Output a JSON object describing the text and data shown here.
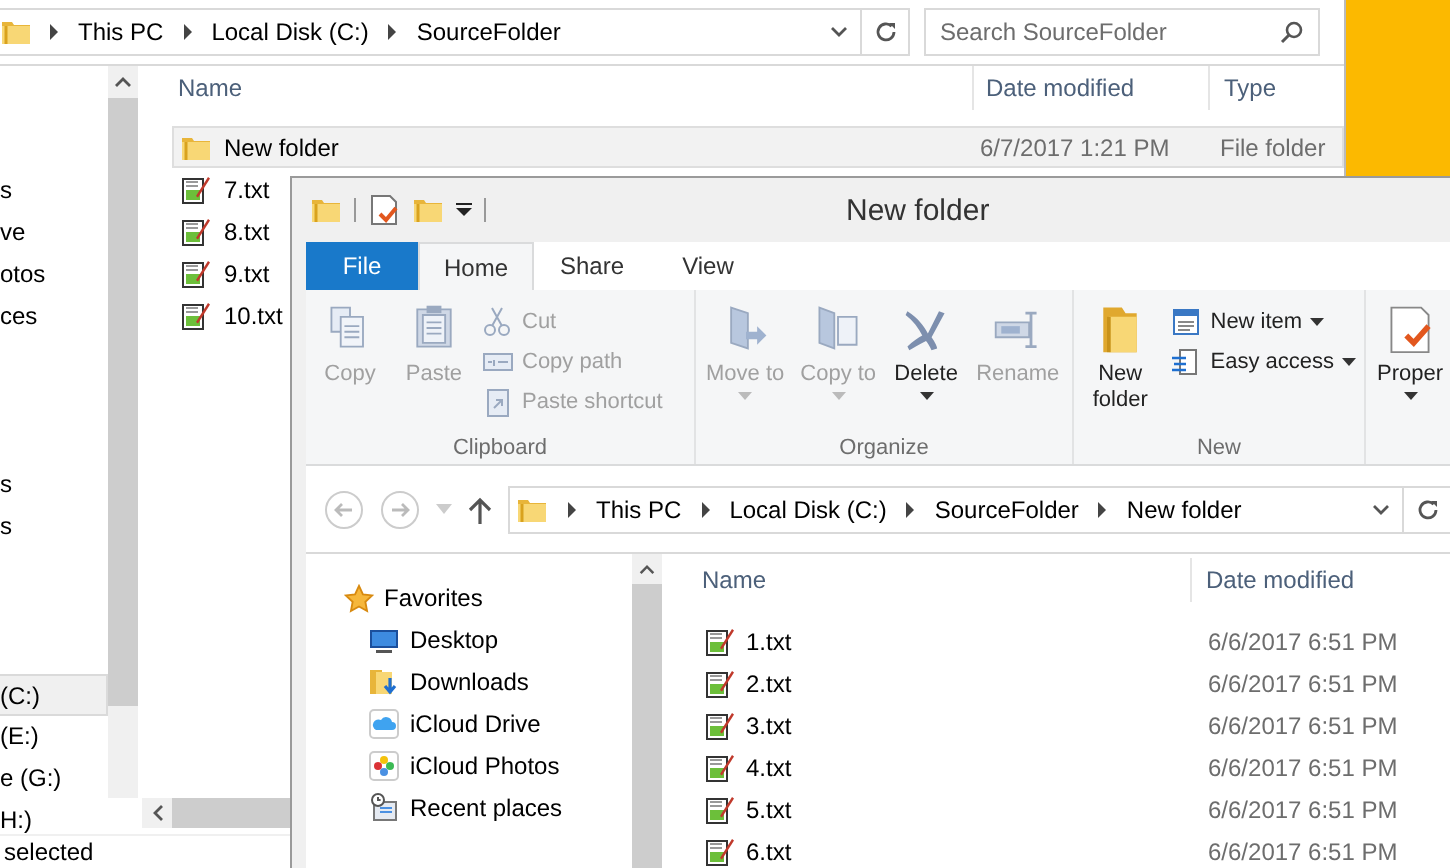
{
  "back_window": {
    "address_bar": {
      "crumbs": [
        "This PC",
        "Local Disk (C:)",
        "SourceFolder"
      ]
    },
    "search": {
      "placeholder": "Search SourceFolder"
    },
    "nav_groups": [
      [
        {
          "label": "s",
          "selected": false
        },
        {
          "label": "ve",
          "selected": false
        },
        {
          "label": "otos",
          "selected": false
        },
        {
          "label": "ces",
          "selected": false
        }
      ],
      [
        {
          "label": "s",
          "selected": false
        },
        {
          "label": "s",
          "selected": false
        }
      ],
      [
        {
          "label": "(C:)",
          "selected": true
        },
        {
          "label": "(E:)",
          "selected": false
        },
        {
          "label": "e (G:)",
          "selected": false
        },
        {
          "label": "H:)",
          "selected": false
        }
      ]
    ],
    "columns": [
      "Name",
      "Date modified",
      "Type"
    ],
    "rows": [
      {
        "kind": "folder",
        "name": "New folder",
        "date": "6/7/2017 1:21 PM",
        "type": "File folder",
        "selected": true
      },
      {
        "kind": "text",
        "name": "7.txt",
        "selected": false
      },
      {
        "kind": "text",
        "name": "8.txt",
        "selected": false
      },
      {
        "kind": "text",
        "name": "9.txt",
        "selected": false
      },
      {
        "kind": "text",
        "name": "10.txt",
        "selected": false
      }
    ],
    "status_bar": "selected"
  },
  "front_window": {
    "title": "New folder",
    "ribbon_tabs": [
      {
        "kind": "menu",
        "label": "File",
        "selected": false
      },
      {
        "kind": "tab",
        "label": "Home",
        "selected": true
      },
      {
        "kind": "tab",
        "label": "Share",
        "selected": false
      },
      {
        "kind": "tab",
        "label": "View",
        "selected": false
      }
    ],
    "ribbon_groups": [
      {
        "label": "Clipboard",
        "buttons": [
          {
            "kind": "large",
            "label": "Copy",
            "disabled": true,
            "dropdown": false
          },
          {
            "kind": "large",
            "label": "Paste",
            "disabled": true,
            "dropdown": false
          },
          {
            "kind": "stack",
            "items": [
              {
                "label": "Cut",
                "disabled": true,
                "dropdown": false
              },
              {
                "label": "Copy path",
                "disabled": true,
                "dropdown": false
              },
              {
                "label": "Paste shortcut",
                "disabled": true,
                "dropdown": false
              }
            ]
          }
        ]
      },
      {
        "label": "Organize",
        "buttons": [
          {
            "kind": "large",
            "label": "Move to",
            "disabled": true,
            "dropdown": true
          },
          {
            "kind": "large",
            "label": "Copy to",
            "disabled": true,
            "dropdown": true
          },
          {
            "kind": "large",
            "label": "Delete",
            "disabled": false,
            "dropdown": true
          },
          {
            "kind": "large",
            "label": "Rename",
            "disabled": true,
            "dropdown": false
          }
        ]
      },
      {
        "label": "New",
        "buttons": [
          {
            "kind": "large",
            "label": "New folder",
            "disabled": false,
            "dropdown": false
          },
          {
            "kind": "stack",
            "items": [
              {
                "label": "New item",
                "disabled": false,
                "dropdown": true
              },
              {
                "label": "Easy access",
                "disabled": false,
                "dropdown": true
              }
            ]
          }
        ]
      },
      {
        "buttons": [
          {
            "kind": "large",
            "label": "Proper",
            "disabled": false,
            "dropdown": true
          }
        ]
      }
    ],
    "address_bar": {
      "crumbs": [
        "This PC",
        "Local Disk (C:)",
        "SourceFolder",
        "New folder"
      ]
    },
    "nav": {
      "heading": "Favorites",
      "items": [
        {
          "label": "Desktop"
        },
        {
          "label": "Downloads"
        },
        {
          "label": "iCloud Drive"
        },
        {
          "label": "iCloud Photos"
        },
        {
          "label": "Recent places"
        }
      ]
    },
    "columns": [
      "Name",
      "Date modified"
    ],
    "rows": [
      {
        "kind": "text",
        "name": "1.txt",
        "date": "6/6/2017 6:51 PM"
      },
      {
        "kind": "text",
        "name": "2.txt",
        "date": "6/6/2017 6:51 PM"
      },
      {
        "kind": "text",
        "name": "3.txt",
        "date": "6/6/2017 6:51 PM"
      },
      {
        "kind": "text",
        "name": "4.txt",
        "date": "6/6/2017 6:51 PM"
      },
      {
        "kind": "text",
        "name": "5.txt",
        "date": "6/6/2017 6:51 PM"
      },
      {
        "kind": "text",
        "name": "6.txt",
        "date": "6/6/2017 6:51 PM"
      }
    ]
  }
}
